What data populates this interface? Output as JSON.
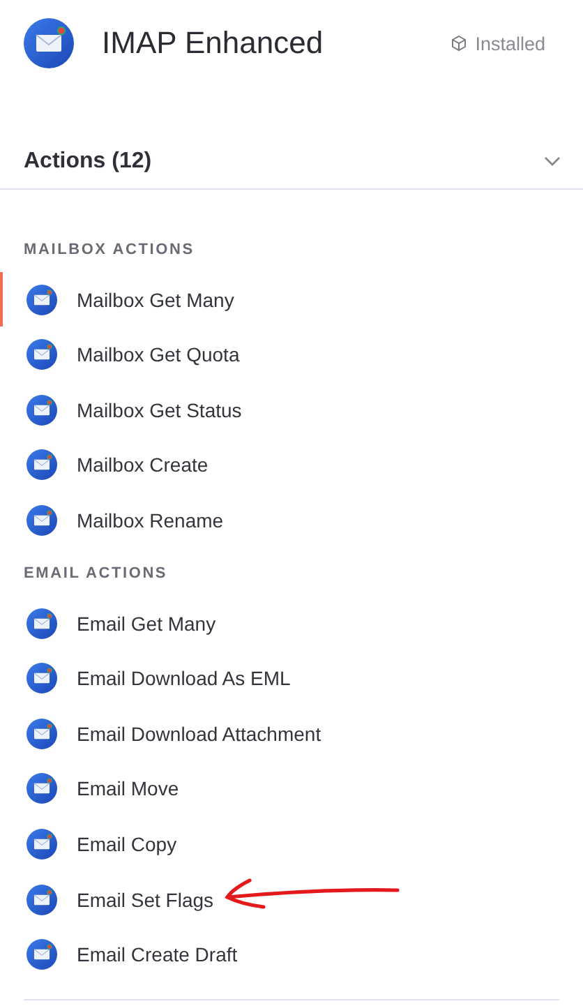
{
  "header": {
    "title": "IMAP Enhanced",
    "status": "Installed"
  },
  "actions": {
    "title": "Actions (12)",
    "expanded": true,
    "sections": [
      {
        "label": "MAILBOX ACTIONS",
        "items": [
          {
            "label": "Mailbox Get Many",
            "selected": true,
            "marked": false
          },
          {
            "label": "Mailbox Get Quota",
            "selected": false,
            "marked": false
          },
          {
            "label": "Mailbox Get Status",
            "selected": false,
            "marked": false
          },
          {
            "label": "Mailbox Create",
            "selected": false,
            "marked": false
          },
          {
            "label": "Mailbox Rename",
            "selected": false,
            "marked": false
          }
        ]
      },
      {
        "label": "EMAIL ACTIONS",
        "items": [
          {
            "label": "Email Get Many",
            "selected": false,
            "marked": false
          },
          {
            "label": "Email Download As EML",
            "selected": false,
            "marked": false
          },
          {
            "label": "Email Download Attachment",
            "selected": false,
            "marked": false
          },
          {
            "label": "Email Move",
            "selected": false,
            "marked": false
          },
          {
            "label": "Email Copy",
            "selected": false,
            "marked": false
          },
          {
            "label": "Email Set Flags",
            "selected": false,
            "marked": true
          },
          {
            "label": "Email Create Draft",
            "selected": false,
            "marked": false
          }
        ]
      }
    ]
  }
}
